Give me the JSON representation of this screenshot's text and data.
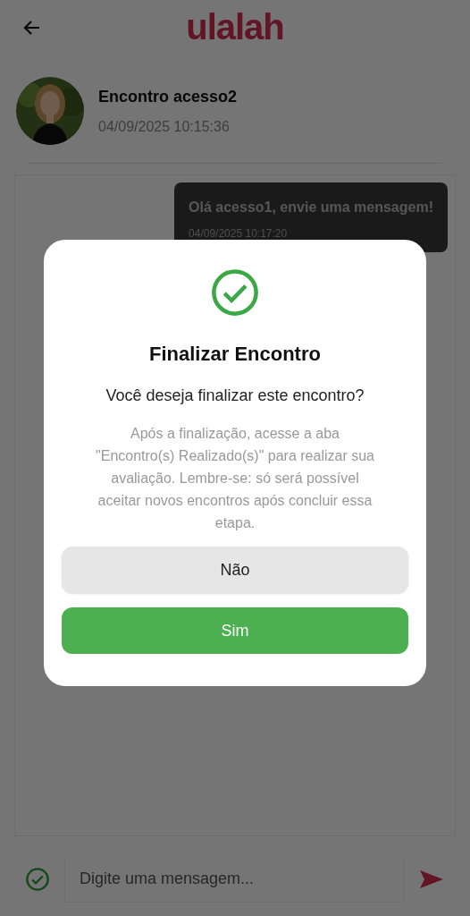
{
  "header": {
    "logo": "ulalah"
  },
  "contact": {
    "name": "Encontro acesso2",
    "time": "04/09/2025 10:15:36"
  },
  "messages": [
    {
      "text": "Olá acesso1, envie uma mensagem!",
      "time": "04/09/2025 10:17:20"
    }
  ],
  "composer": {
    "placeholder": "Digite uma mensagem..."
  },
  "dialog": {
    "title": "Finalizar Encontro",
    "question": "Você deseja finalizar este encontro?",
    "body": "Após a finalização, acesse a aba \"Encontro(s) Realizado(s)\" para realizar sua avaliação. Lembre-se: só será possível aceitar novos encontros após concluir essa etapa.",
    "buttons": [
      {
        "label": "Não",
        "kind": "secondary"
      },
      {
        "label": "Sim",
        "kind": "primary"
      }
    ]
  }
}
